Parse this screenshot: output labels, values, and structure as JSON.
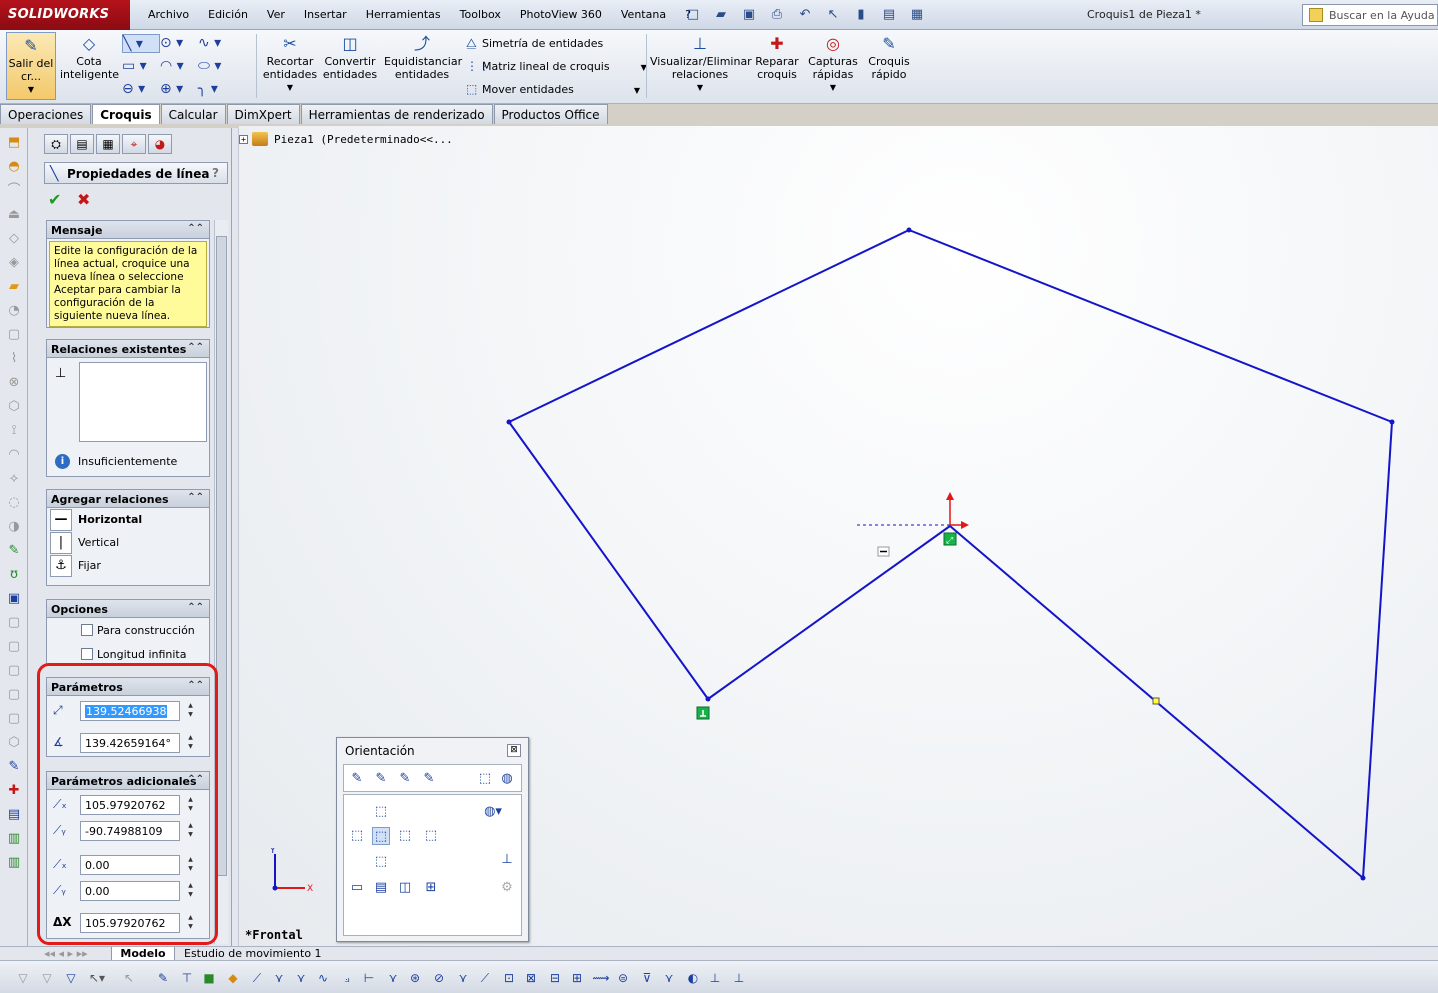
{
  "app": {
    "logo": "SOLIDWORKS",
    "document_title": "Croquis1 de Pieza1 *",
    "help_search_placeholder": "Buscar en la Ayuda de"
  },
  "menu": [
    "Archivo",
    "Edición",
    "Ver",
    "Insertar",
    "Herramientas",
    "Toolbox",
    "PhotoView 360",
    "Ventana",
    "?"
  ],
  "commands": {
    "salir": "Salir del cr...",
    "cota": "Cota inteligente",
    "recortar": "Recortar entidades",
    "convertir": "Convertir entidades",
    "equidistanciar": "Equidistanciar entidades",
    "simetria": "Simetría de entidades",
    "matriz": "Matriz lineal de croquis",
    "mover": "Mover entidades",
    "visualizar": "Visualizar/Eliminar relaciones",
    "reparar": "Reparar croquis",
    "capturas": "Capturas rápidas",
    "croquis_rapido": "Croquis rápido"
  },
  "tabs": [
    "Operaciones",
    "Croquis",
    "Calcular",
    "DimXpert",
    "Herramientas de renderizado",
    "Productos Office"
  ],
  "active_tab": "Croquis",
  "property_manager": {
    "title": "Propiedades de línea",
    "help": "?",
    "mensaje": {
      "header": "Mensaje",
      "text": "Edite la configuración de la línea actual, croquice una nueva línea o seleccione Aceptar para cambiar la configuración de la siguiente nueva línea."
    },
    "relaciones_existentes": {
      "header": "Relaciones existentes",
      "status": "Insuficientemente"
    },
    "agregar_relaciones": {
      "header": "Agregar relaciones",
      "items": [
        "Horizontal",
        "Vertical",
        "Fijar"
      ]
    },
    "opciones": {
      "header": "Opciones",
      "construccion": "Para construcción",
      "infinita": "Longitud infinita"
    },
    "parametros": {
      "header": "Parámetros",
      "length": "139.52466938",
      "angle": "139.42659164°"
    },
    "parametros_adicionales": {
      "header": "Parámetros adicionales",
      "start_x": "105.97920762",
      "start_y": "-90.74988109",
      "end_x": "0.00",
      "end_y": "0.00",
      "delta_x": "105.97920762",
      "delta_x_label": "ΔX"
    }
  },
  "graphics": {
    "tree_item": "Pieza1  (Predeterminado<<...",
    "view_name": "*Frontal",
    "axis_x": "X",
    "axis_y": "Y"
  },
  "orientation_dialog": {
    "title": "Orientación",
    "close": "⊠"
  },
  "bottom_tabs": [
    "Modelo",
    "Estudio de movimiento 1"
  ],
  "colors": {
    "sketch_line": "#1414c8",
    "highlight_frame": "#e11a1a",
    "message_bg": "#fffb9b"
  }
}
